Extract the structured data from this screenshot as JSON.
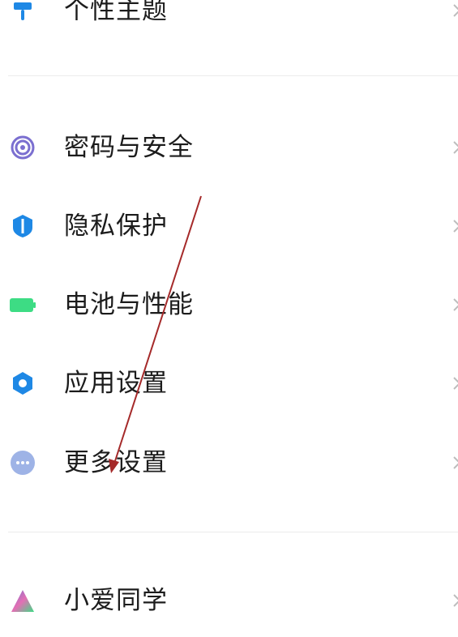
{
  "settings": {
    "items": [
      {
        "label": "个性主题",
        "icon": "brush-icon",
        "color": "#1e88e5"
      },
      {
        "label": "密码与安全",
        "icon": "fingerprint-icon",
        "color": "#7b6fd0"
      },
      {
        "label": "隐私保护",
        "icon": "shield-icon",
        "color": "#1e88e5"
      },
      {
        "label": "电池与性能",
        "icon": "battery-icon",
        "color": "#3ddc84"
      },
      {
        "label": "应用设置",
        "icon": "gear-icon",
        "color": "#1e88e5"
      },
      {
        "label": "更多设置",
        "icon": "more-dots-icon",
        "color": "#9eb3e6"
      },
      {
        "label": "小爱同学",
        "icon": "xiaoai-icon",
        "color": "#7b6fd0"
      }
    ]
  },
  "annotation": {
    "color": "#a52a2a"
  }
}
